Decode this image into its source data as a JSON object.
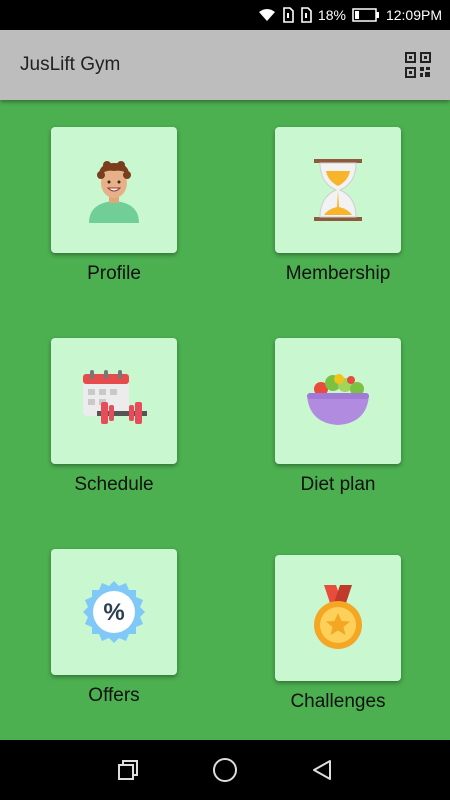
{
  "status_bar": {
    "battery_percent": "18%",
    "time": "12:09PM",
    "icons": [
      "wifi-icon",
      "sim1-icon",
      "sim2-icon",
      "battery-icon"
    ]
  },
  "app_bar": {
    "title": "JusLift Gym",
    "qr_icon": "qr-code-icon"
  },
  "tiles": [
    {
      "label": "Profile",
      "icon": "profile-avatar-icon"
    },
    {
      "label": "Membership",
      "icon": "hourglass-icon"
    },
    {
      "label": "Schedule",
      "icon": "calendar-dumbbell-icon"
    },
    {
      "label": "Diet plan",
      "icon": "salad-bowl-icon"
    },
    {
      "label": "Offers",
      "icon": "discount-badge-icon"
    },
    {
      "label": "Challenges",
      "icon": "medal-icon"
    }
  ],
  "nav_bar": {
    "icons": [
      "recent-apps-icon",
      "home-icon",
      "back-icon"
    ]
  },
  "colors": {
    "background": "#4caf50",
    "app_bar": "#bdbdbd",
    "tile": "#c8f7d0"
  }
}
